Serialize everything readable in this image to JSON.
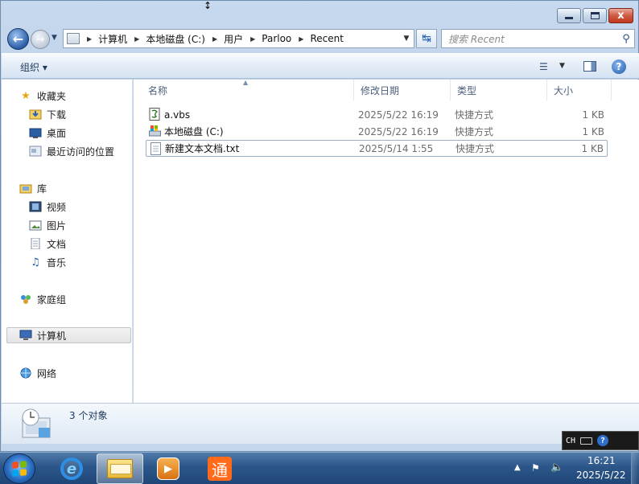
{
  "window": {
    "close_glyph": "x"
  },
  "address": {
    "crumbs": [
      "计算机",
      "本地磁盘 (C:)",
      "用户",
      "Parloo",
      "Recent"
    ],
    "search_placeholder": "搜索 Recent"
  },
  "toolbar": {
    "organize_label": "组织 ▾",
    "help_label": "?"
  },
  "nav": {
    "favorites": {
      "label": "收藏夹",
      "items": [
        "下载",
        "桌面",
        "最近访问的位置"
      ]
    },
    "libraries": {
      "label": "库",
      "items": [
        "视频",
        "图片",
        "文档",
        "音乐"
      ]
    },
    "homegroup": "家庭组",
    "computer": "计算机",
    "network": "网络"
  },
  "columns": [
    "名称",
    "修改日期",
    "类型",
    "大小"
  ],
  "files": [
    {
      "name": "a.vbs",
      "date": "2025/5/22 16:19",
      "type": "快捷方式",
      "size": "1 KB",
      "icon": "script-icon"
    },
    {
      "name": "本地磁盘 (C:)",
      "date": "2025/5/22 16:19",
      "type": "快捷方式",
      "size": "1 KB",
      "icon": "drive-icon"
    },
    {
      "name": "新建文本文档.txt",
      "date": "2025/5/14 1:55",
      "type": "快捷方式",
      "size": "1 KB",
      "icon": "text-file-icon"
    }
  ],
  "status": {
    "count_text": "3 个对象"
  },
  "ime": {
    "lang": "CH",
    "help": "?"
  },
  "taskbar": {
    "apps": [
      "internet-explorer-icon",
      "file-explorer-icon",
      "media-player-icon",
      "tong-app-icon"
    ],
    "tong_glyph": "通",
    "time": "16:21",
    "date": "2025/5/22"
  },
  "colors": {
    "accent": "#2a62b6",
    "taskbar": "#2c5689",
    "close": "#c1381d"
  }
}
